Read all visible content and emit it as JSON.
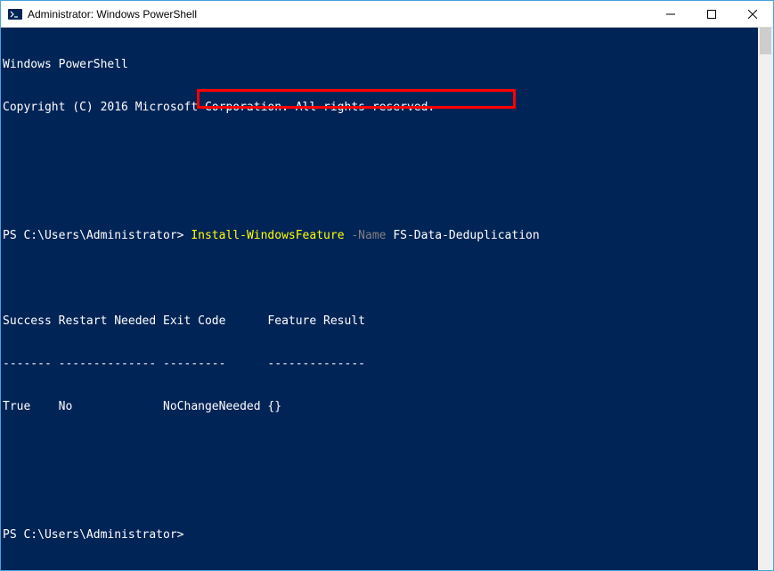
{
  "window": {
    "title": "Administrator: Windows PowerShell"
  },
  "terminal": {
    "banner_line1": "Windows PowerShell",
    "banner_line2": "Copyright (C) 2016 Microsoft Corporation. All rights reserved.",
    "prompt": "PS C:\\Users\\Administrator>",
    "cmdlet": "Install-WindowsFeature",
    "param_name": "-Name",
    "param_value": "FS-Data-Deduplication",
    "table_header": "Success Restart Needed Exit Code      Feature Result",
    "table_divider": "------- -------------- ---------      --------------",
    "table_row": "True    No             NoChangeNeeded {}",
    "prompt2": "PS C:\\Users\\Administrator>"
  }
}
